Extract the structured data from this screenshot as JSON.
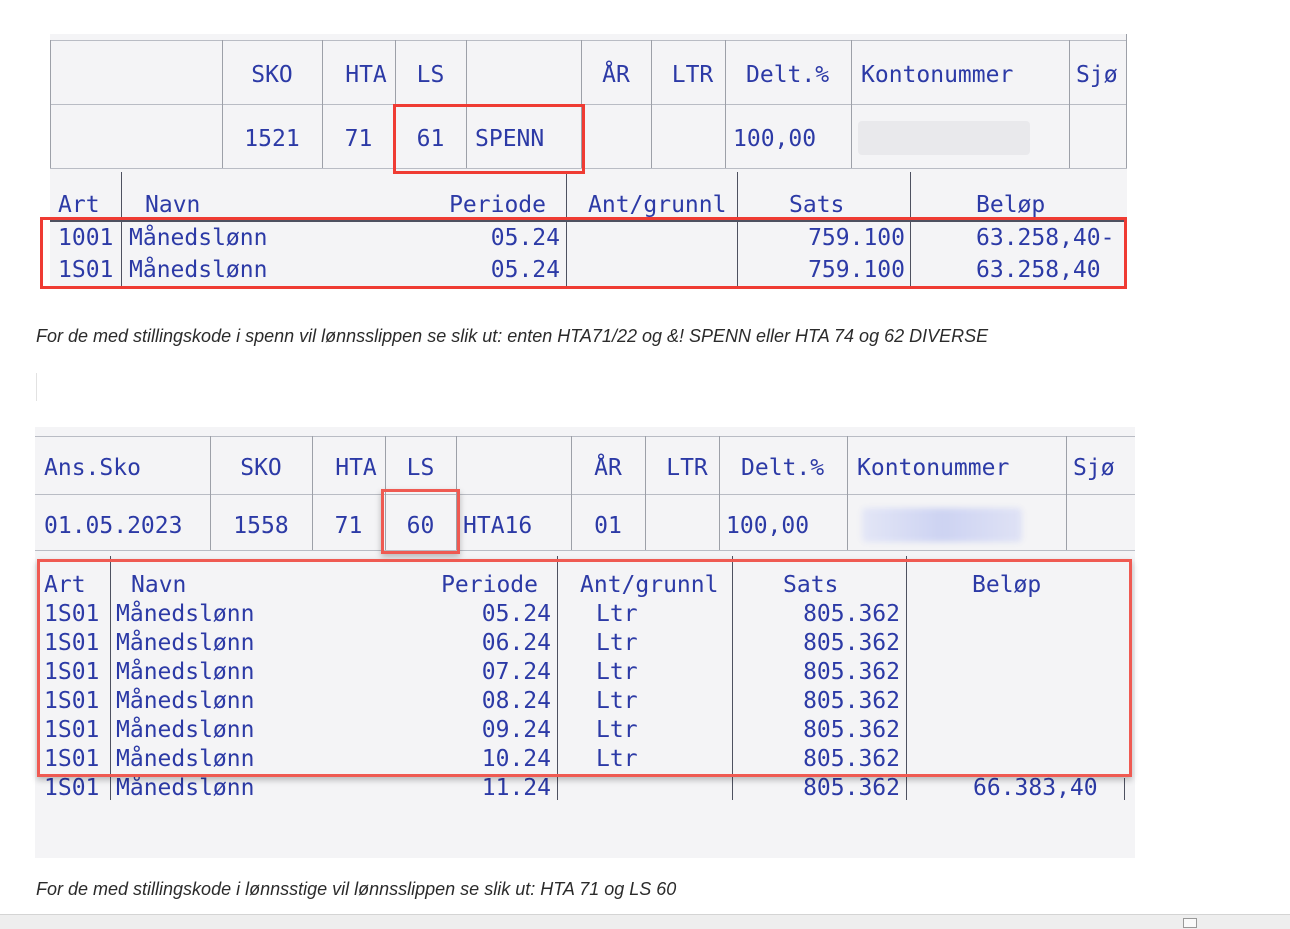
{
  "table1": {
    "header": [
      "SKO",
      "HTA",
      "LS",
      "ÅR",
      "LTR",
      "Delt.%",
      "Kontonummer",
      "Sjø"
    ],
    "row": {
      "sko": "1521",
      "hta": "71",
      "ls": "61",
      "ls_text": "SPENN",
      "delt": "100,00"
    },
    "lines_header": [
      "Art",
      "Navn",
      "Periode",
      "Ant/grunnl",
      "Sats",
      "Beløp"
    ],
    "lines": [
      {
        "art": "1001",
        "navn": "Månedslønn",
        "periode": "05.24",
        "sats": "759.100",
        "belop": "63.258,40-"
      },
      {
        "art": "1S01",
        "navn": "Månedslønn",
        "periode": "05.24",
        "sats": "759.100",
        "belop": "63.258,40"
      }
    ]
  },
  "caption1": "For de med stillingskode i spenn vil lønnsslippen se slik ut: enten HTA71/22 og &! SPENN eller HTA 74 og 62 DIVERSE",
  "table2": {
    "header": [
      "Ans.Sko",
      "SKO",
      "HTA",
      "LS",
      "ÅR",
      "LTR",
      "Delt.%",
      "Kontonummer",
      "Sjø"
    ],
    "row": {
      "ans_sko": "01.05.2023",
      "sko": "1558",
      "hta": "71",
      "ls": "60",
      "ls_text": "HTA16",
      "ar": "01",
      "delt": "100,00"
    },
    "lines_header": [
      "Art",
      "Navn",
      "Periode",
      "Ant/grunnl",
      "Sats",
      "Beløp"
    ],
    "lines": [
      {
        "art": "1S01",
        "navn": "Månedslønn",
        "periode": "05.24",
        "ant": "Ltr",
        "sats": "805.362",
        "belop": ""
      },
      {
        "art": "1S01",
        "navn": "Månedslønn",
        "periode": "06.24",
        "ant": "Ltr",
        "sats": "805.362",
        "belop": ""
      },
      {
        "art": "1S01",
        "navn": "Månedslønn",
        "periode": "07.24",
        "ant": "Ltr",
        "sats": "805.362",
        "belop": ""
      },
      {
        "art": "1S01",
        "navn": "Månedslønn",
        "periode": "08.24",
        "ant": "Ltr",
        "sats": "805.362",
        "belop": ""
      },
      {
        "art": "1S01",
        "navn": "Månedslønn",
        "periode": "09.24",
        "ant": "Ltr",
        "sats": "805.362",
        "belop": ""
      },
      {
        "art": "1S01",
        "navn": "Månedslønn",
        "periode": "10.24",
        "ant": "Ltr",
        "sats": "805.362",
        "belop": ""
      },
      {
        "art": "1S01",
        "navn": "Månedslønn",
        "periode": "11.24",
        "ant": "",
        "sats": "805.362",
        "belop": "66.383,40"
      }
    ]
  },
  "caption2": "For de med stillingskode i lønnsstige vil lønnsslippen se slik ut: HTA 71 og LS 60",
  "colors": {
    "text": "#2c3aa6",
    "highlight": "#ef3b33",
    "panel": "#f4f4f6"
  }
}
